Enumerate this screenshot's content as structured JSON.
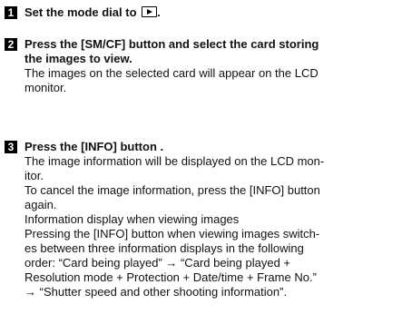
{
  "steps": [
    {
      "number": "1",
      "title_before_icon": "Set the mode dial to",
      "icon": "playback-icon",
      "title_after_icon": "."
    },
    {
      "number": "2",
      "title_lines": [
        "Press the [SM/CF] button and select the card storing",
        "the images to view."
      ],
      "body_lines": [
        "The images on the selected card will appear on the LCD",
        "monitor."
      ]
    },
    {
      "number": "3",
      "title": "Press the [INFO] button .",
      "body_lines": [
        "The image information will be displayed on the LCD mon-",
        "itor.",
        "To cancel the image information, press the [INFO] button",
        "again.",
        "Information display when viewing images",
        "Pressing the [INFO] button when viewing images switch-",
        "es between three information displays in the following",
        "order: “Card being played” → “Card being played +",
        "Resolution mode + Protection + Date/time + Frame No.”",
        "→ “Shutter speed and other shooting information”."
      ]
    }
  ]
}
